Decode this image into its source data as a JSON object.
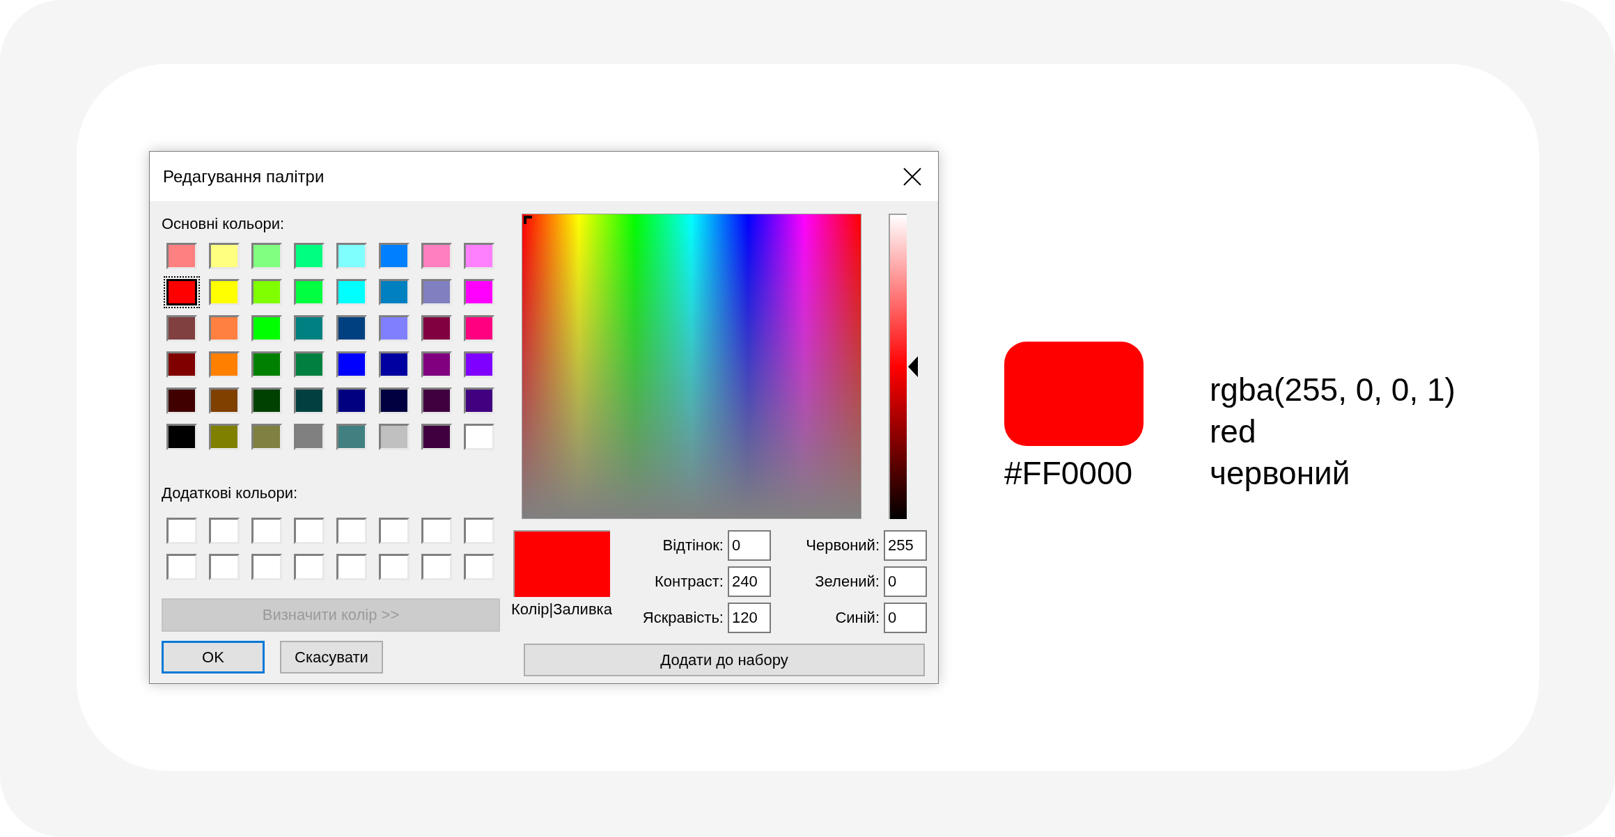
{
  "dialog": {
    "title": "Редагування палітри",
    "basic_colors": {
      "label": "Основні кольори:",
      "swatches": [
        {
          "color": "#ff8080",
          "selected": false
        },
        {
          "color": "#ffff80",
          "selected": false
        },
        {
          "color": "#80ff80",
          "selected": false
        },
        {
          "color": "#00ff80",
          "selected": false
        },
        {
          "color": "#80ffff",
          "selected": false
        },
        {
          "color": "#0080ff",
          "selected": false
        },
        {
          "color": "#ff80c0",
          "selected": false
        },
        {
          "color": "#ff80ff",
          "selected": false
        },
        {
          "color": "#ff0000",
          "selected": true
        },
        {
          "color": "#ffff00",
          "selected": false
        },
        {
          "color": "#80ff00",
          "selected": false
        },
        {
          "color": "#00ff40",
          "selected": false
        },
        {
          "color": "#00ffff",
          "selected": false
        },
        {
          "color": "#0080c0",
          "selected": false
        },
        {
          "color": "#8080c0",
          "selected": false
        },
        {
          "color": "#ff00ff",
          "selected": false
        },
        {
          "color": "#804040",
          "selected": false
        },
        {
          "color": "#ff8040",
          "selected": false
        },
        {
          "color": "#00ff00",
          "selected": false
        },
        {
          "color": "#008080",
          "selected": false
        },
        {
          "color": "#004080",
          "selected": false
        },
        {
          "color": "#8080ff",
          "selected": false
        },
        {
          "color": "#800040",
          "selected": false
        },
        {
          "color": "#ff0080",
          "selected": false
        },
        {
          "color": "#800000",
          "selected": false
        },
        {
          "color": "#ff8000",
          "selected": false
        },
        {
          "color": "#008000",
          "selected": false
        },
        {
          "color": "#008040",
          "selected": false
        },
        {
          "color": "#0000ff",
          "selected": false
        },
        {
          "color": "#0000a0",
          "selected": false
        },
        {
          "color": "#800080",
          "selected": false
        },
        {
          "color": "#8000ff",
          "selected": false
        },
        {
          "color": "#400000",
          "selected": false
        },
        {
          "color": "#804000",
          "selected": false
        },
        {
          "color": "#004000",
          "selected": false
        },
        {
          "color": "#004040",
          "selected": false
        },
        {
          "color": "#000080",
          "selected": false
        },
        {
          "color": "#000040",
          "selected": false
        },
        {
          "color": "#400040",
          "selected": false
        },
        {
          "color": "#400080",
          "selected": false
        },
        {
          "color": "#000000",
          "selected": false
        },
        {
          "color": "#808000",
          "selected": false
        },
        {
          "color": "#808040",
          "selected": false
        },
        {
          "color": "#808080",
          "selected": false
        },
        {
          "color": "#408080",
          "selected": false
        },
        {
          "color": "#c0c0c0",
          "selected": false
        },
        {
          "color": "#400040",
          "selected": false
        },
        {
          "color": "#ffffff",
          "selected": false
        }
      ]
    },
    "custom_colors": {
      "label": "Додаткові кольори:",
      "swatches": [
        {
          "color": "#ffffff"
        },
        {
          "color": "#ffffff"
        },
        {
          "color": "#ffffff"
        },
        {
          "color": "#ffffff"
        },
        {
          "color": "#ffffff"
        },
        {
          "color": "#ffffff"
        },
        {
          "color": "#ffffff"
        },
        {
          "color": "#ffffff"
        },
        {
          "color": "#ffffff"
        },
        {
          "color": "#ffffff"
        },
        {
          "color": "#ffffff"
        },
        {
          "color": "#ffffff"
        },
        {
          "color": "#ffffff"
        },
        {
          "color": "#ffffff"
        },
        {
          "color": "#ffffff"
        },
        {
          "color": "#ffffff"
        }
      ]
    },
    "define_button": {
      "label": "Визначити колір >>",
      "disabled": true
    },
    "luminance": {
      "level": 0.5
    },
    "preview": {
      "color": "#ff0000",
      "label": "Колір|Заливка"
    },
    "fields": [
      {
        "label": "Відтінок:",
        "value": "0"
      },
      {
        "label": "Червоний:",
        "value": "255"
      },
      {
        "label": "Контраст:",
        "value": "240"
      },
      {
        "label": "Зелений:",
        "value": "0"
      },
      {
        "label": "Яскравість:",
        "value": "120"
      },
      {
        "label": "Синій:",
        "value": "0"
      }
    ],
    "add_button": "Додати до набору",
    "buttons": [
      {
        "label": "OK",
        "default": true
      },
      {
        "label": "Скасувати",
        "default": false
      }
    ]
  },
  "color_info": {
    "color": "#ff0000",
    "hex": "#FF0000",
    "lines": [
      "rgba(255, 0, 0, 1)",
      "red",
      "червоний"
    ]
  }
}
